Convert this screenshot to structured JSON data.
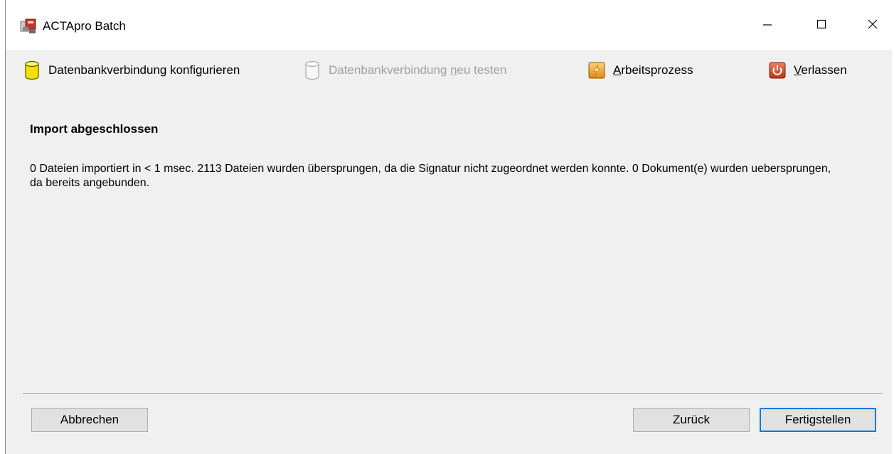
{
  "window": {
    "title": "ACTApro Batch"
  },
  "toolbar": {
    "db_config": {
      "label": "Datenbankverbindung konfigurieren",
      "icon": "database-icon",
      "enabled": true
    },
    "db_test": {
      "label_before": "Datenbankverbindung ",
      "label_mnemonic": "n",
      "label_after": "eu testen",
      "icon": "database-icon",
      "enabled": false
    },
    "workflow": {
      "label_mnemonic": "A",
      "label_after": "rbeitsprozess",
      "icon": "lightning-icon",
      "enabled": true
    },
    "exit": {
      "label_mnemonic": "V",
      "label_after": "erlassen",
      "icon": "power-icon",
      "enabled": true
    }
  },
  "content": {
    "title": "Import abgeschlossen",
    "message": "0 Dateien importiert in < 1 msec. 2113 Dateien wurden übersprungen, da die Signatur nicht zugeordnet werden konnte. 0 Dokument(e) wurden uebersprungen, da bereits angebunden."
  },
  "footer": {
    "cancel_label": "Abbrechen",
    "back_label": "Zurück",
    "finish_label": "Fertigstellen"
  },
  "colors": {
    "window_background": "#f0f0f0",
    "button_background": "#e1e1e1",
    "focus_border": "#0078d7",
    "disabled_text": "#a0a0a0",
    "db_icon_fill": "#f5e100",
    "workflow_icon_fill": "#f0a030",
    "exit_icon_fill": "#d94a2a"
  }
}
